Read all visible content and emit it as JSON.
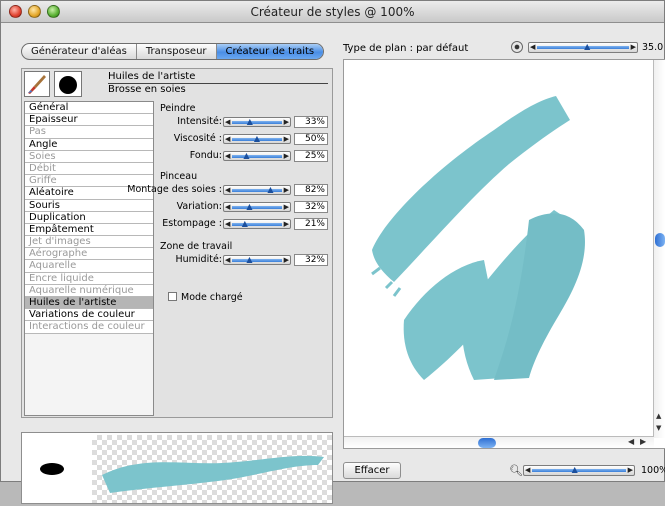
{
  "window": {
    "title": "Créateur de styles @ 100%"
  },
  "tabs": [
    {
      "label": "Générateur d'aléas",
      "active": false
    },
    {
      "label": "Transposeur",
      "active": false
    },
    {
      "label": "Créateur de traits",
      "active": true
    }
  ],
  "brush": {
    "category": "Huiles de l'artiste",
    "variant": "Brosse en soies"
  },
  "categories": [
    {
      "label": "Général",
      "enabled": true
    },
    {
      "label": "Epaisseur",
      "enabled": true
    },
    {
      "label": "Pas",
      "enabled": false
    },
    {
      "label": "Angle",
      "enabled": true
    },
    {
      "label": "Soies",
      "enabled": false
    },
    {
      "label": "Débit",
      "enabled": false
    },
    {
      "label": "Griffe",
      "enabled": false
    },
    {
      "label": "Aléatoire",
      "enabled": true
    },
    {
      "label": "Souris",
      "enabled": true
    },
    {
      "label": "Duplication",
      "enabled": true
    },
    {
      "label": "Empâtement",
      "enabled": true
    },
    {
      "label": "Jet d'images",
      "enabled": false
    },
    {
      "label": "Aérographe",
      "enabled": false
    },
    {
      "label": "Aquarelle",
      "enabled": false
    },
    {
      "label": "Encre liquide",
      "enabled": false
    },
    {
      "label": "Aquarelle numérique",
      "enabled": false
    },
    {
      "label": "Huiles de l'artiste",
      "enabled": true,
      "selected": true
    },
    {
      "label": "Variations de couleur",
      "enabled": true
    },
    {
      "label": "Interactions de couleur",
      "enabled": false
    }
  ],
  "sections": {
    "peindre": {
      "title": "Peindre",
      "rows": [
        {
          "label": "Intensité:",
          "value": "33%",
          "level": 0.33
        },
        {
          "label": "Viscosité :",
          "value": "50%",
          "level": 0.5
        },
        {
          "label": "Fondu:",
          "value": "25%",
          "level": 0.25
        }
      ]
    },
    "pinceau": {
      "title": "Pinceau",
      "rows": [
        {
          "label": "Montage des soies :",
          "value": "82%",
          "level": 0.82
        },
        {
          "label": "Variation:",
          "value": "32%",
          "level": 0.32
        },
        {
          "label": "Estompage :",
          "value": "21%",
          "level": 0.21
        }
      ]
    },
    "zone": {
      "title": "Zone de travail",
      "rows": [
        {
          "label": "Humidité:",
          "value": "32%",
          "level": 0.32
        }
      ]
    }
  },
  "checkbox": {
    "label": "Mode chargé",
    "checked": false
  },
  "plan": {
    "label": "Type de plan : par défaut",
    "value": "35.0",
    "level": 0.55
  },
  "buttons": {
    "clear": "Effacer"
  },
  "zoom": {
    "value": "100%",
    "level": 0.45
  },
  "colors": {
    "paint": "#7cc4cc",
    "accent": "#4a8ee6"
  }
}
